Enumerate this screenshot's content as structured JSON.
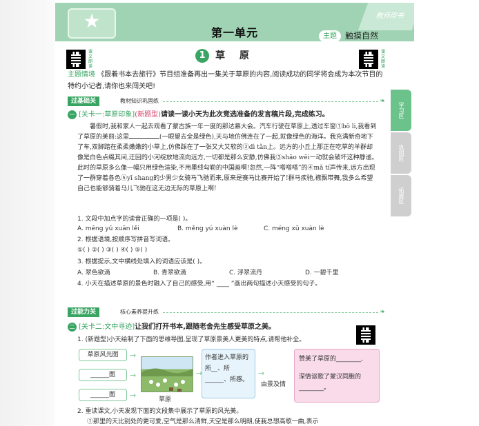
{
  "header": {
    "unit": "第一单元",
    "theme_badge": "主题",
    "theme_text": "触摸自然",
    "corner": "教师用书"
  },
  "qr_top": {
    "label_left": "课文朗读",
    "label_right": "课文朗读"
  },
  "lesson": {
    "number": "1",
    "title": "草 原"
  },
  "intro": {
    "tag": "主题情境",
    "text": "《跟着书本去旅行》节目组准备再出一集关于草原的内容,阅读成功的同学将会成为本次节目的特约小记者,请你也来闯关吧!"
  },
  "section1": {
    "label": "过基础关",
    "sub": "教材知识巩固练"
  },
  "task1": {
    "num": "一",
    "key": "[关卡一:草原印象]",
    "newtag": "(新题型)",
    "text": "请读一读小天为此次竞选准备的发言稿片段,完成练习。"
  },
  "passage": {
    "p1": "暑假时,我和家人一起去观看了蒙古族一年一度的那达慕大会。汽车行驶在草原上,透过车窗①bō li,我看到了草原的美丽:这里",
    "p1_after": "(一眼望去全是绿色),天与地仿佛连在了一起,就像绿色的海洋。我充满新奇地下了车,双脚踏在柔柔嫩嫩的小草上,仿佛踩在了一张又大又软的②dì tǎn上。远方的小丘上那正在吃草的羊群却像是白色点缀其间,迂回的小河绽放地流向远方,一切都是那么安静,仿佛我③shāo wēi一动就会破坏这种静谧。此时的草原多么像一幅只用绿色渲染,不用墨线勾勒的中国画啊!忽然,一阵“嗒嗒嗒”的④mǎ tí声传来,远方出现了一群穿着各色⑤yī shang的少男少女骑马飞驰而来,原来是赛马比赛开始了!群马疾驰,襟飘带舞,我多么希望自己也能够骑着马儿飞驰在这无边无际的草原上啊!"
  },
  "q1": {
    "text": "1. 文段中加点字的读音正确的一项是(        )。",
    "a": "A. mēng  yǔ  xuān  lěi",
    "b": "B. měng  yú  xuàn  lè",
    "c": "C. méng  xǔ  xuàn  lè"
  },
  "q2": {
    "text": "2. 根据语境,按顺序写拼音写词语。",
    "blanks": "①(          )  ②(          )  ③(          )  ④(          )  ⑤(          )"
  },
  "q3": {
    "text": "3. 根据提示,文中横线处填入的词语应该是(        )。",
    "a": "A. 翠色欲滴",
    "b": "B. 青翠欲滴",
    "c": "C. 浮翠流丹",
    "d": "D. 一碧千里"
  },
  "q4": {
    "text": "4. 小天在描述草原的景色时融入了自己的感受,用“ ____ ”画出两句描述小天感受的句子。"
  },
  "section2": {
    "label": "过能力关",
    "sub": "核心素养提升练"
  },
  "task2": {
    "num": "二",
    "key": "[关卡二:文中寻迹]",
    "text": "让我们打开书本,跟随老舍先生感受草原之美。"
  },
  "q5": {
    "text": "1. (新题型)小天绘制了下面的思维导图,呈现了草原景美人更美的特点,请帮他补全。"
  },
  "mindmap": {
    "b1": "草原风光图",
    "b2": "______图",
    "b3": "______图",
    "img_label": "草原",
    "mid": "作者进入草原的所__、所______、所感。",
    "arrow_label": "由景及情",
    "right1": "赞美了草原的________,",
    "right2": "深情讴歌了蒙汉同胞的________。"
  },
  "q6": {
    "text": "2. 重读课文,小天发现下面的文段集中展示了草原的风光美。"
  },
  "q6_passage": "①那里的天比别处的更可爱,空气是那么清鲜,天空是那么明朗,使我总想高歌一曲,表示",
  "tabs": {
    "t1": "学习区",
    "t2": "巩固区",
    "t3": "拓展区"
  },
  "colors": {
    "green": "#3aa563",
    "light_green": "#9fd3b3",
    "pink": "#d6476f",
    "tab_green": "#6cc28b",
    "tab_grey": "#cfcfcf"
  }
}
